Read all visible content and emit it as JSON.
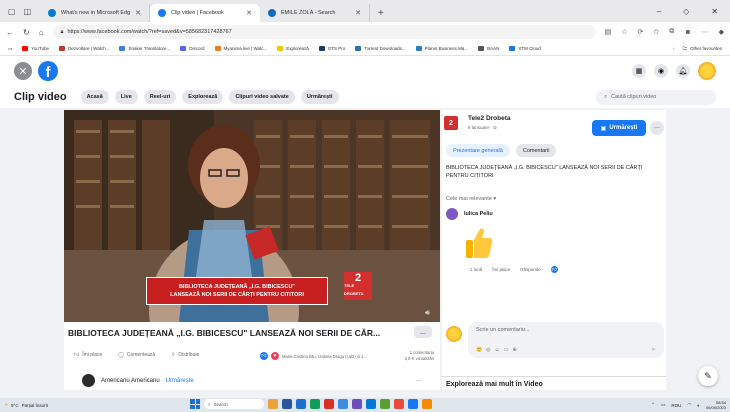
{
  "browser": {
    "tabs": [
      {
        "label": "What's new in Microsoft Edge",
        "color": "#0078d4"
      },
      {
        "label": "Clip video | Facebook",
        "color": "#1877f2"
      },
      {
        "label": "EMILE ZOLA - Search",
        "color": "#0f6cbd"
      }
    ],
    "new_tab": "+",
    "win_minimize": "–",
    "win_maximize": "◇",
    "win_close": "✕",
    "url": "https://www.facebook.com/watch/?ref=saved&v=585682317428767",
    "favorites": [
      {
        "label": "YouTube",
        "color": "#ff0000"
      },
      {
        "label": "Dezvoltare | Watch...",
        "color": "#c0392b"
      },
      {
        "label": "Snaker Translatore...",
        "color": "#3f7fd8"
      },
      {
        "label": "Discord",
        "color": "#5865f2"
      },
      {
        "label": "Myanima live | Watc...",
        "color": "#e67e22"
      },
      {
        "label": "Explorează",
        "color": "#f1c40f"
      },
      {
        "label": "GTS Pro",
        "color": "#1f3a5f"
      },
      {
        "label": "Torrent Downloads...",
        "color": "#2c6fb7"
      },
      {
        "label": "Planet Business Ma...",
        "color": "#2980b9"
      },
      {
        "label": "BAAN",
        "color": "#555555"
      },
      {
        "label": "XTM Cloud",
        "color": "#1a73e8"
      }
    ],
    "other_favorites": "Other favourites"
  },
  "fb": {
    "brand_color": "#1877f2",
    "close_glyph": "✕",
    "logo_glyph": "f",
    "top_icons": [
      "grid-icon",
      "messenger-icon",
      "bell-icon"
    ]
  },
  "video_nav": {
    "title": "Clip video",
    "chips": [
      "Acasă",
      "Live",
      "Reel-uri",
      "Explorează",
      "Clipuri video salvate",
      "Urmărești"
    ],
    "search_placeholder": "Caută clipuri video"
  },
  "video": {
    "lower_third_line1": "BIBLIOTECA JUDEȚEANĂ „I.G. BIBICESCU\"",
    "lower_third_line2": "LANSEAZĂ NOI SERII DE CĂRȚI PENTRU CITITORI",
    "channel_logo_number": "2",
    "channel_logo_text": "TELE DROBETA",
    "post_title": "BIBLIOTECA JUDEȚEANĂ „I.G. BIBICESCU\" LANSEAZĂ NOI SERII DE CĂR...",
    "more_label": "...",
    "actions": [
      "Îmi place",
      "Comentează",
      "Distribuie"
    ],
    "reactions_text": "Maria Cristina Ilău, Izabela Dragu (cal2) și 1...",
    "comments_count": "1 comentariu",
    "views": "2,6 K vizualizări"
  },
  "side": {
    "page_name": "Tele2 Drobeta",
    "page_meta": "8 lansuare · ⊘",
    "follow_label": "Urmărești",
    "more_label": "···",
    "tabs": [
      "Prezentare generală",
      "Comentarii"
    ],
    "description": "BIBLIOTECA JUDEȚEANĂ „I.G. BIBICESCU\" LANSEAZĂ NOI SERII DE CĂRȚI PENTRU CITITORI",
    "sort_label": "Cele mai relevante ▾",
    "comment_author": "Iulica Peliu",
    "comment_actions": [
      "1 lună",
      "Îmi place",
      "Răspunde"
    ],
    "comment_box_placeholder": "Scrie un comentariu...",
    "comment_box_icons": [
      "🙂",
      "◎",
      "☺",
      "▭",
      "⊕"
    ],
    "send_glyph": "➤",
    "explore_title": "Explorează mai mult în Video"
  },
  "next_post": {
    "author": "Americanu Americanu",
    "follow": "Urmărește",
    "dots": "···"
  },
  "taskbar": {
    "temp": "9°C",
    "weather_desc": "Parțial însorit",
    "search_label": "Search",
    "lang": "ROU",
    "time": "08:54",
    "date": "06/05/2023",
    "apps": [
      "#e9a23b",
      "#2b579a",
      "#1f6fd1",
      "#0f9d58",
      "#d93025",
      "#3c8dde",
      "#6c4fbb",
      "#0078d4",
      "#5a9e33",
      "#e74c3c",
      "#1877f2",
      "#f28b00"
    ]
  }
}
